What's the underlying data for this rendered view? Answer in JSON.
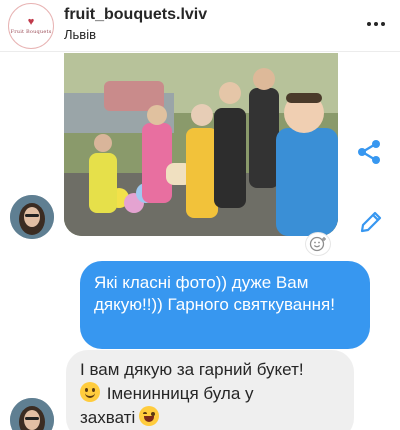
{
  "header": {
    "username": "fruit_bouquets.lviv",
    "location": "Львів",
    "logo_icon": "brand-logo",
    "more_icon": "more-dots-icon"
  },
  "chat": {
    "messages": [
      {
        "type": "image",
        "direction": "incoming",
        "content": "group-photo-with-bouquet"
      },
      {
        "type": "text",
        "direction": "outgoing",
        "text": "Які класні фото)) дуже Вам дякую!!)) Гарного святкування!"
      },
      {
        "type": "text",
        "direction": "incoming",
        "text_line1": "І вам дякую за гарний букет!",
        "text_line2": "Іменинниця була у",
        "text_line3": "захваті"
      }
    ],
    "side_actions": [
      "share-icon",
      "edit-icon"
    ],
    "reaction_icon": "add-reaction-icon"
  },
  "colors": {
    "outgoing_bubble": "#3797f0",
    "incoming_bubble": "#efefef",
    "accent": "#3797f0"
  }
}
